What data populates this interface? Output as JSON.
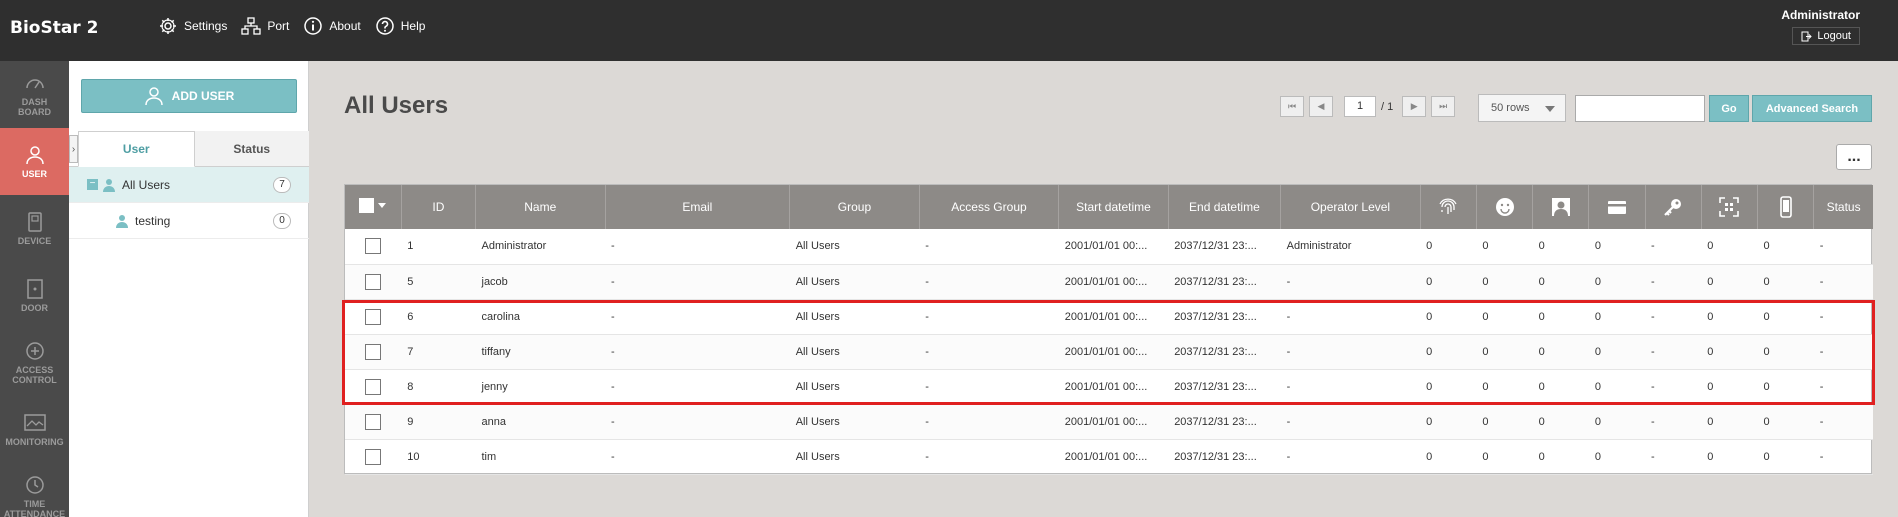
{
  "app": {
    "title": "BioStar 2"
  },
  "topnav": {
    "settings": "Settings",
    "port": "Port",
    "about": "About",
    "help": "Help"
  },
  "user_menu": {
    "name": "Administrator",
    "logout": "Logout"
  },
  "leftnav": {
    "items": [
      {
        "label": "DASH\nBOARD",
        "icon": "dashboard-icon"
      },
      {
        "label": "USER",
        "icon": "user-icon",
        "active": true
      },
      {
        "label": "DEVICE",
        "icon": "device-icon"
      },
      {
        "label": "DOOR",
        "icon": "door-icon"
      },
      {
        "label": "ACCESS\nCONTROL",
        "icon": "access-control-icon"
      },
      {
        "label": "MONITORING",
        "icon": "monitoring-icon"
      },
      {
        "label": "TIME\nATTENDANCE",
        "icon": "clock-icon"
      }
    ]
  },
  "sidebar": {
    "add_user": "ADD USER",
    "tabs": [
      {
        "label": "User"
      },
      {
        "label": "Status"
      }
    ],
    "tree": [
      {
        "label": "All Users",
        "count": "7"
      },
      {
        "label": "testing",
        "count": "0"
      }
    ]
  },
  "main": {
    "title": "All Users",
    "pager": {
      "page": "1",
      "total": "/ 1"
    },
    "rows_select": "50 rows",
    "search": {
      "placeholder": "",
      "value": ""
    },
    "go": "Go",
    "advanced_search": "Advanced Search",
    "more": "..."
  },
  "table": {
    "headers": {
      "id": "ID",
      "name": "Name",
      "email": "Email",
      "group": "Group",
      "access_group": "Access Group",
      "start": "Start datetime",
      "end": "End datetime",
      "operator": "Operator Level",
      "status": "Status"
    },
    "icon_headers": [
      "fingerprint-icon",
      "face-icon",
      "photo-icon",
      "card-icon",
      "key-icon",
      "qr-code-icon",
      "mobile-icon"
    ],
    "rows": [
      {
        "id": "1",
        "name": "Administrator",
        "email": "-",
        "group": "All Users",
        "access_group": "-",
        "start": "2001/01/01 00:...",
        "end": "2037/12/31 23:...",
        "operator": "Administrator",
        "fp": "0",
        "face": "0",
        "photo": "0",
        "card": "0",
        "key": "-",
        "qr": "0",
        "mobile": "0",
        "status": "-"
      },
      {
        "id": "5",
        "name": "jacob",
        "email": "-",
        "group": "All Users",
        "access_group": "-",
        "start": "2001/01/01 00:...",
        "end": "2037/12/31 23:...",
        "operator": "-",
        "fp": "0",
        "face": "0",
        "photo": "0",
        "card": "0",
        "key": "-",
        "qr": "0",
        "mobile": "0",
        "status": "-"
      },
      {
        "id": "6",
        "name": "carolina",
        "email": "-",
        "group": "All Users",
        "access_group": "-",
        "start": "2001/01/01 00:...",
        "end": "2037/12/31 23:...",
        "operator": "-",
        "fp": "0",
        "face": "0",
        "photo": "0",
        "card": "0",
        "key": "-",
        "qr": "0",
        "mobile": "0",
        "status": "-"
      },
      {
        "id": "7",
        "name": "tiffany",
        "email": "-",
        "group": "All Users",
        "access_group": "-",
        "start": "2001/01/01 00:...",
        "end": "2037/12/31 23:...",
        "operator": "-",
        "fp": "0",
        "face": "0",
        "photo": "0",
        "card": "0",
        "key": "-",
        "qr": "0",
        "mobile": "0",
        "status": "-"
      },
      {
        "id": "8",
        "name": "jenny",
        "email": "-",
        "group": "All Users",
        "access_group": "-",
        "start": "2001/01/01 00:...",
        "end": "2037/12/31 23:...",
        "operator": "-",
        "fp": "0",
        "face": "0",
        "photo": "0",
        "card": "0",
        "key": "-",
        "qr": "0",
        "mobile": "0",
        "status": "-"
      },
      {
        "id": "9",
        "name": "anna",
        "email": "-",
        "group": "All Users",
        "access_group": "-",
        "start": "2001/01/01 00:...",
        "end": "2037/12/31 23:...",
        "operator": "-",
        "fp": "0",
        "face": "0",
        "photo": "0",
        "card": "0",
        "key": "-",
        "qr": "0",
        "mobile": "0",
        "status": "-"
      },
      {
        "id": "10",
        "name": "tim",
        "email": "-",
        "group": "All Users",
        "access_group": "-",
        "start": "2001/01/01 00:...",
        "end": "2037/12/31 23:...",
        "operator": "-",
        "fp": "0",
        "face": "0",
        "photo": "0",
        "card": "0",
        "key": "-",
        "qr": "0",
        "mobile": "0",
        "status": "-"
      }
    ]
  },
  "colors": {
    "accent": "#7bbfc4",
    "active_nav": "#dc6a62",
    "highlight": "#e02020",
    "header_bg": "#8d8a87"
  }
}
